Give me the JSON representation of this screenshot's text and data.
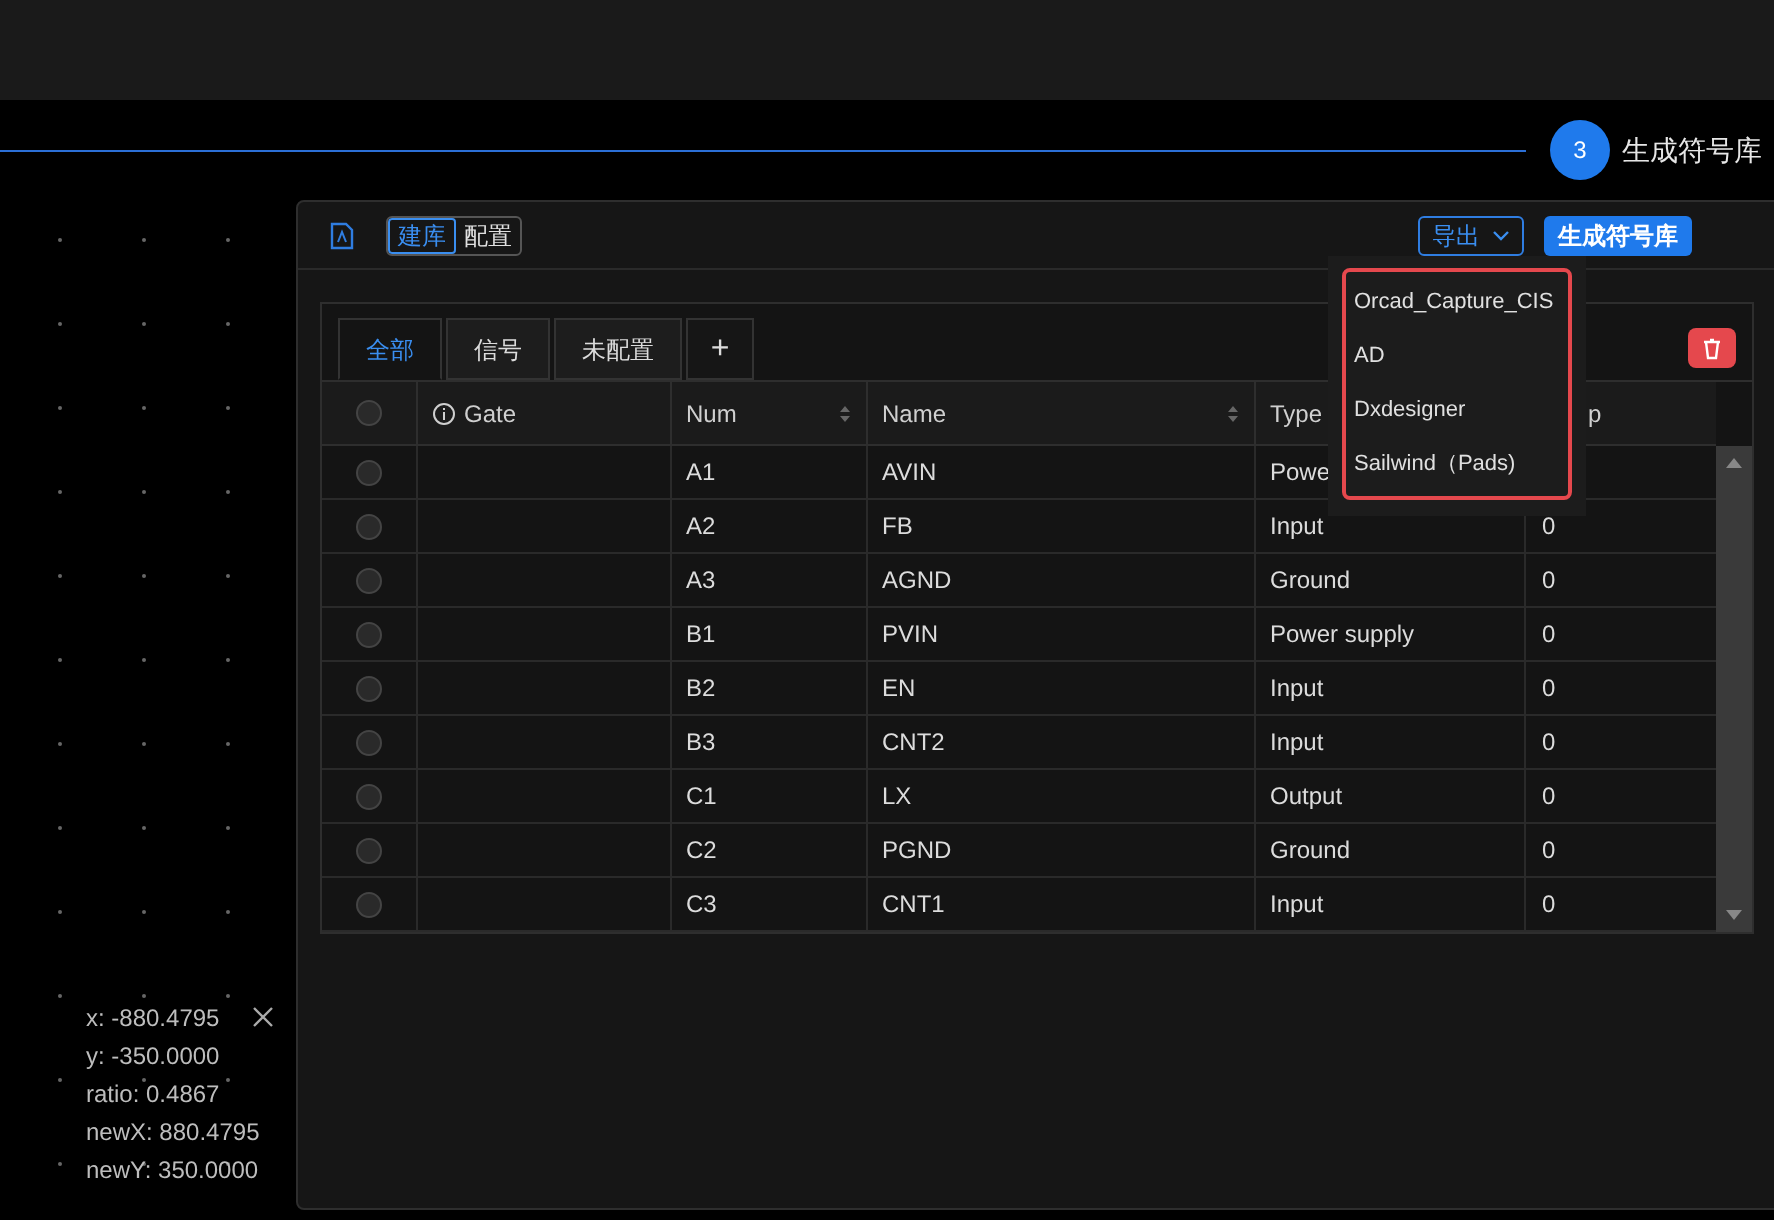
{
  "step": {
    "number": "3",
    "label": "生成符号库"
  },
  "toolbar": {
    "modes": [
      {
        "label": "建库",
        "selected": true
      },
      {
        "label": "配置",
        "selected": false
      }
    ],
    "export_button": "导出",
    "generate_button": "生成符号库"
  },
  "export_menu": {
    "items": [
      "Orcad_Capture_CIS",
      "AD",
      "Dxdesigner",
      "Sailwind（Pads)"
    ]
  },
  "tabs": [
    {
      "label": "全部",
      "selected": true
    },
    {
      "label": "信号",
      "selected": false
    },
    {
      "label": "未配置",
      "selected": false
    }
  ],
  "add_tab": "+",
  "table": {
    "all_checked": false,
    "columns": [
      "Gate",
      "Num",
      "Name",
      "Type",
      "p"
    ],
    "rows": [
      {
        "checked": false,
        "num": "A1",
        "name": "AVIN",
        "type": "Powe"
      },
      {
        "checked": false,
        "num": "A2",
        "name": "FB",
        "type": "Input",
        "column_6": "0"
      },
      {
        "checked": false,
        "num": "A3",
        "name": "AGND",
        "type": "Ground",
        "column_6": "0"
      },
      {
        "checked": false,
        "num": "B1",
        "name": "PVIN",
        "type": "Power supply",
        "column_6": "0"
      },
      {
        "checked": false,
        "num": "B2",
        "name": "EN",
        "type": "Input",
        "column_6": "0"
      },
      {
        "checked": false,
        "num": "B3",
        "name": "CNT2",
        "type": "Input",
        "column_6": "0"
      },
      {
        "checked": false,
        "num": "C1",
        "name": "LX",
        "type": "Output",
        "column_6": "0"
      },
      {
        "checked": false,
        "num": "C2",
        "name": "PGND",
        "type": "Ground",
        "column_6": "0"
      },
      {
        "checked": false,
        "num": "C3",
        "name": "CNT1",
        "type": "Input",
        "column_6": "0"
      }
    ]
  },
  "coordinates": [
    "x: -880.4795",
    "y: -350.0000",
    "ratio: 0.4867",
    "newX: 880.4795",
    "newY: 350.0000"
  ]
}
